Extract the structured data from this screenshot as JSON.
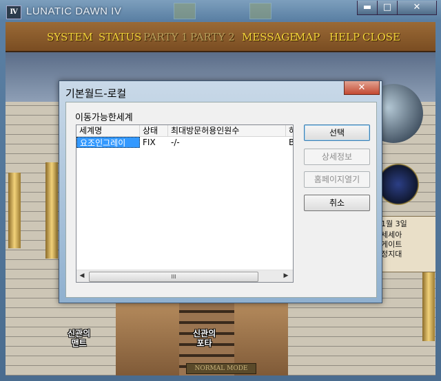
{
  "window": {
    "app_icon": "Ⅳ",
    "title": "LUNATIC DAWN IV",
    "min_label": "▬",
    "max_label": "□",
    "close_label": "✕"
  },
  "menu": {
    "system": "SYSTEM",
    "status": "STATUS",
    "party1": "PARTY 1",
    "party2": "PARTY 2",
    "message": "MESSAGE",
    "map": "MAP",
    "help": "HELP",
    "close": "CLOSE"
  },
  "scene": {
    "date": "1월 3일",
    "info_line1": "세세아",
    "info_line2": "게이트",
    "info_line3": "정지대",
    "place1": "신관의\n맨트",
    "place2": "신관의\n포타",
    "mode": "NORMAL MODE"
  },
  "dialog": {
    "title": "기본월드-로컬",
    "close_label": "✕",
    "group_label": "이동가능한세계",
    "columns": [
      "세계명",
      "상태",
      "최대방문허용인원수",
      "허"
    ],
    "rows": [
      {
        "name": "요조인그레이",
        "status": "FIX",
        "max": "-/-",
        "extra": "B"
      }
    ],
    "scroll_thumb": "III",
    "buttons": {
      "select": "선택",
      "details": "상세정보",
      "homepage": "홈페이지열기",
      "cancel": "취소"
    }
  }
}
